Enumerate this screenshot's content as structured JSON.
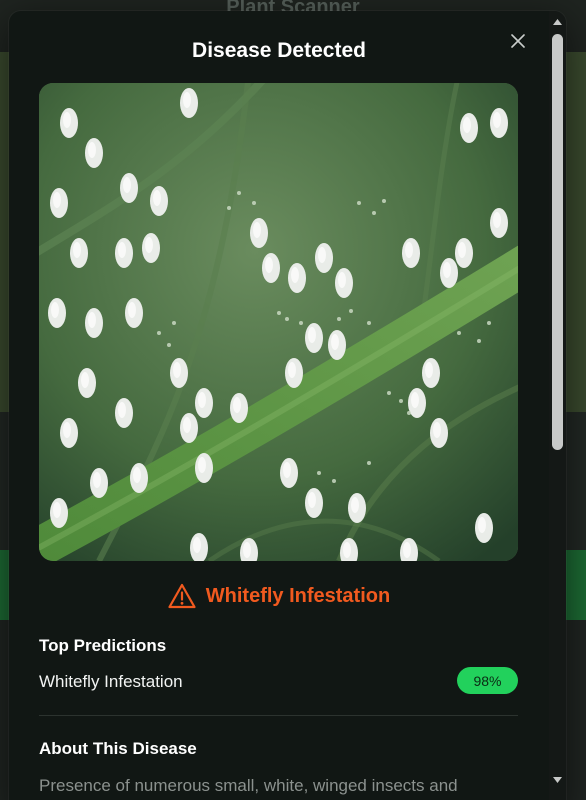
{
  "background": {
    "app_title": "Plant Scanner"
  },
  "modal": {
    "title": "Disease Detected",
    "close_icon": "close-icon",
    "image_subject": "whitefly-leaf-photo",
    "result": {
      "icon": "warning-triangle-icon",
      "label": "Whitefly Infestation",
      "color": "#f15a1f"
    },
    "top_predictions": {
      "heading": "Top Predictions",
      "items": [
        {
          "name": "Whitefly Infestation",
          "confidence": "98%"
        }
      ]
    },
    "about": {
      "heading": "About This Disease",
      "text": "Presence of numerous small, white, winged insects and"
    }
  },
  "colors": {
    "modal_bg": "#111714",
    "accent_green": "#22d15c",
    "warning_orange": "#f15a1f"
  }
}
